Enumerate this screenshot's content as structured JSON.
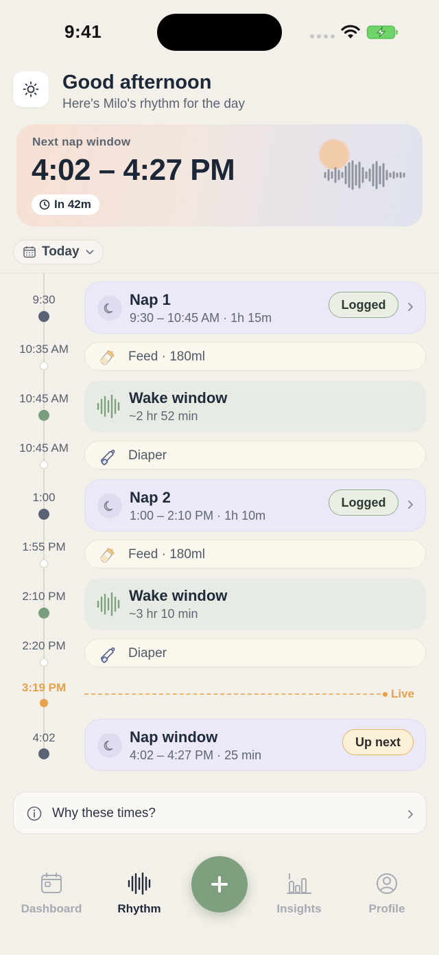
{
  "status_bar": {
    "time": "9:41"
  },
  "header": {
    "greeting": "Good afternoon",
    "subtitle": "Here's Milo's rhythm for the day"
  },
  "next_nap": {
    "label": "Next nap window",
    "time_range": "4:02 – 4:27 PM",
    "countdown": "In 42m"
  },
  "date_filter": {
    "label": "Today"
  },
  "timeline": {
    "entries": [
      {
        "time": "9:30",
        "title": "Nap 1",
        "subtitle": "9:30 – 10:45 AM · 1h 15m",
        "badge": "Logged"
      },
      {
        "time": "10:35 AM",
        "text": "Feed · 180ml"
      },
      {
        "time": "10:45 AM",
        "title": "Wake window",
        "subtitle": "~2 hr 52 min"
      },
      {
        "time": "10:45 AM",
        "text": "Diaper"
      },
      {
        "time": "1:00",
        "title": "Nap 2",
        "subtitle": "1:00 – 2:10 PM · 1h 10m",
        "badge": "Logged"
      },
      {
        "time": "1:55 PM",
        "text": "Feed · 180ml"
      },
      {
        "time": "2:10 PM",
        "title": "Wake window",
        "subtitle": "~3 hr 10 min"
      },
      {
        "time": "2:20 PM",
        "text": "Diaper"
      },
      {
        "time": "4:02",
        "title": "Nap window",
        "subtitle": "4:02 – 4:27 PM · 25 min",
        "badge": "Up next"
      }
    ],
    "now": {
      "time": "3:19 PM",
      "label": "Live"
    }
  },
  "why_card": {
    "label": "Why these times?"
  },
  "tab_bar": {
    "tabs": [
      {
        "label": "Dashboard"
      },
      {
        "label": "Rhythm"
      },
      {
        "label": "Insights"
      },
      {
        "label": "Profile"
      }
    ],
    "fab_label": "+"
  },
  "colors": {
    "background": "#f3efe9",
    "nap_card": "#ebe8f7",
    "wake_card": "#e6ece3",
    "accent_green": "#7ea07f",
    "live_orange": "#e5a24a"
  }
}
